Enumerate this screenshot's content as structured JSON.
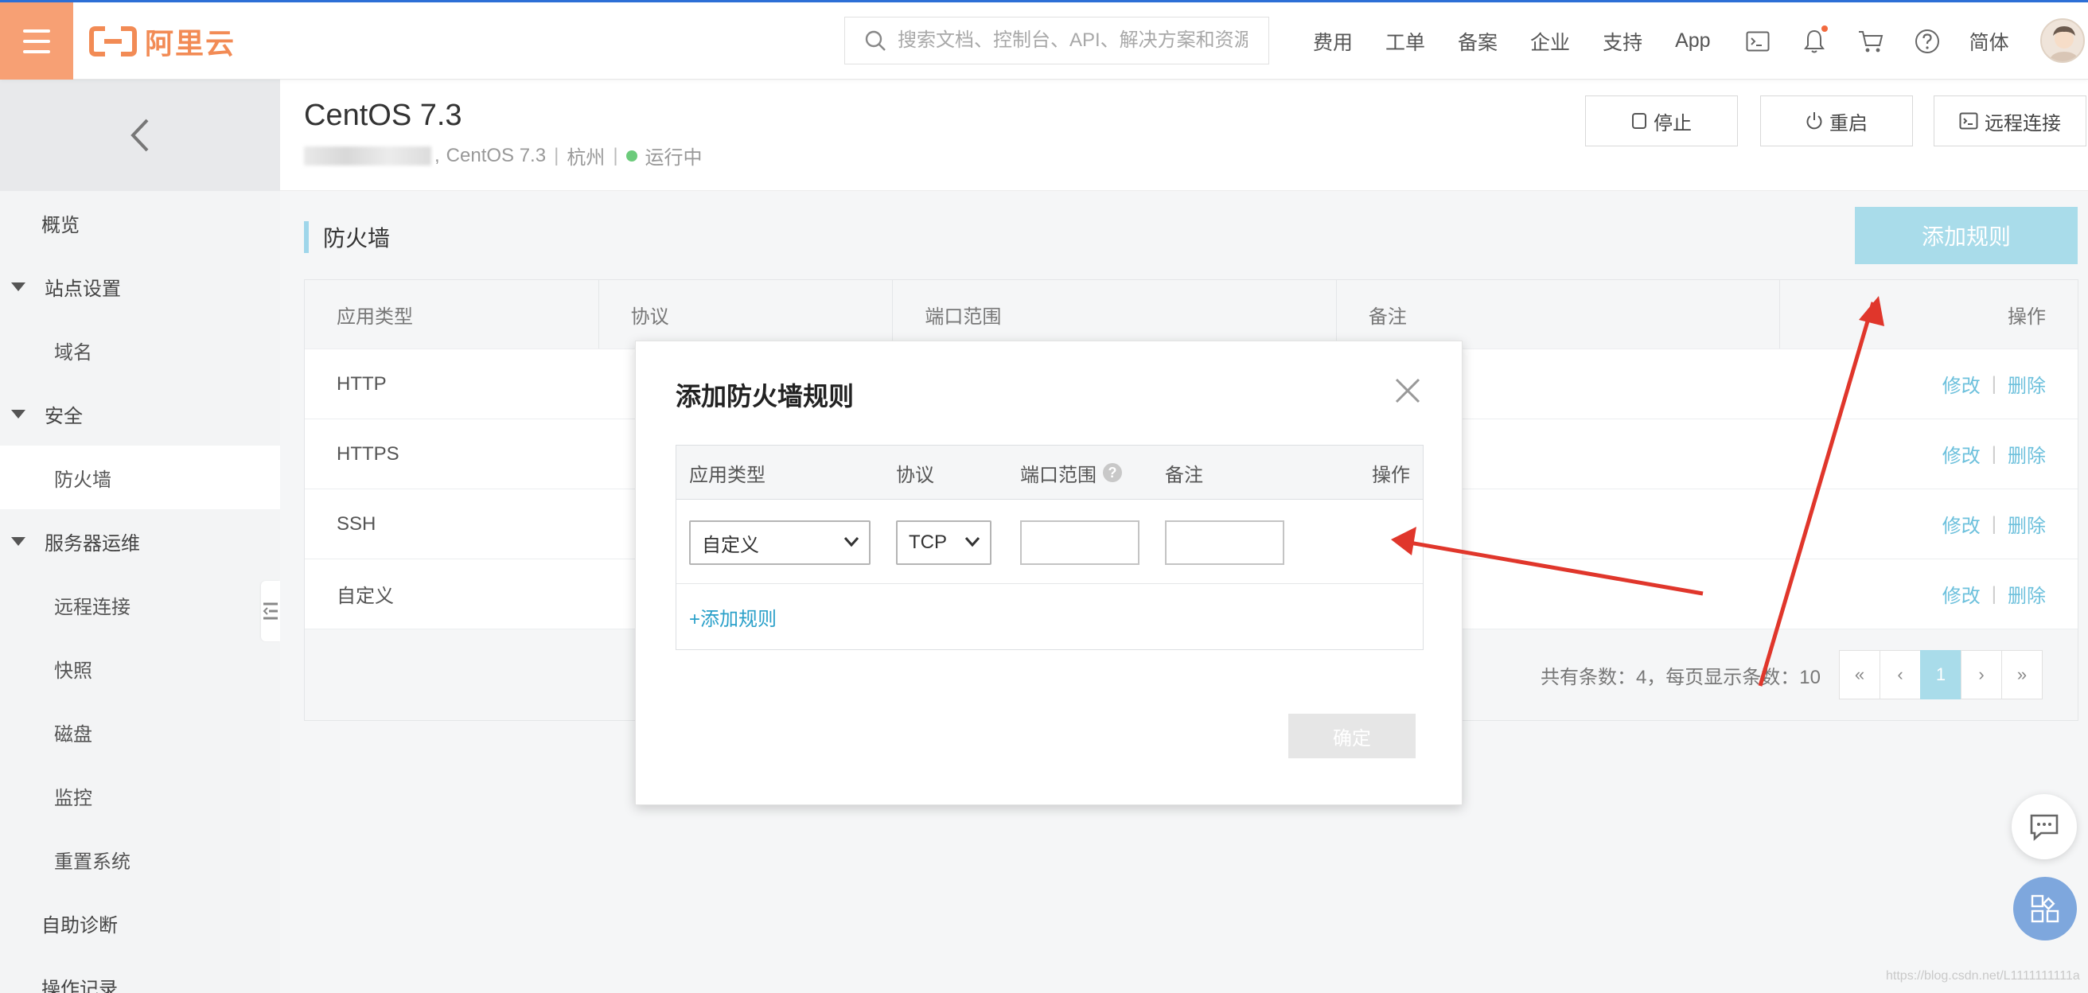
{
  "topbar": {
    "logo_text": "阿里云",
    "search_placeholder": "搜索文档、控制台、API、解决方案和资源",
    "nav_items": [
      "费用",
      "工单",
      "备案",
      "企业",
      "支持",
      "App"
    ],
    "lang": "简体"
  },
  "sidebar": {
    "items": [
      {
        "label": "概览"
      },
      {
        "label": "站点设置"
      },
      {
        "label": "域名"
      },
      {
        "label": "安全"
      },
      {
        "label": "防火墙"
      },
      {
        "label": "服务器运维"
      },
      {
        "label": "远程连接"
      },
      {
        "label": "快照"
      },
      {
        "label": "磁盘"
      },
      {
        "label": "监控"
      },
      {
        "label": "重置系统"
      },
      {
        "label": "自助诊断"
      },
      {
        "label": "操作记录"
      }
    ]
  },
  "header": {
    "title": "CentOS 7.3",
    "os": "CentOS 7.3",
    "region": "杭州",
    "status": "运行中",
    "stop_label": "停止",
    "restart_label": "重启",
    "remote_label": "远程连接"
  },
  "firewall": {
    "section_title": "防火墙",
    "add_rule_label": "添加规则",
    "columns": [
      "应用类型",
      "协议",
      "端口范围",
      "备注",
      "操作"
    ],
    "rows": [
      {
        "app": "HTTP"
      },
      {
        "app": "HTTPS"
      },
      {
        "app": "SSH"
      },
      {
        "app": "自定义"
      }
    ],
    "edit_label": "修改",
    "delete_label": "删除",
    "total_text": "共有条数：4，每页显示条数：10",
    "pager": [
      "«",
      "‹",
      "1",
      "›",
      "»"
    ],
    "current_page": "1"
  },
  "modal": {
    "title": "添加防火墙规则",
    "columns": [
      "应用类型",
      "协议",
      "端口范围",
      "备注",
      "操作"
    ],
    "app_type_value": "自定义",
    "protocol_value": "TCP",
    "add_rule_link": "+添加规则",
    "confirm_label": "确定"
  },
  "watermark": "https://blog.csdn.net/L1111111111a",
  "colors": {
    "brand_orange": "#f7a074",
    "accent_blue": "#a9dcea",
    "link_blue": "#6cc0dc",
    "annotation_red": "#e0362b"
  }
}
